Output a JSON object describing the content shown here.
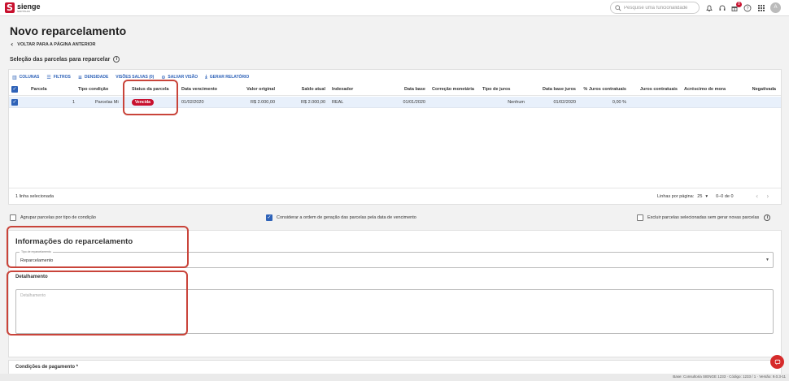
{
  "brand": {
    "name": "sienge",
    "sub": "SOFTPLAN"
  },
  "search": {
    "placeholder": "Pesquise uma funcionalidade"
  },
  "header_icons": [
    "bell-icon",
    "headset-icon",
    "gift-icon",
    "help-icon",
    "apps-grid-icon"
  ],
  "notification_count": "8",
  "avatar_letter": "A",
  "page": {
    "title": "Novo reparcelamento",
    "back_label": "VOLTAR PARA A PÁGINA ANTERIOR",
    "section_label": "Seleção das parcelas para reparcelar"
  },
  "toolbar": {
    "columns": "COLUNAS",
    "filters": "FILTROS",
    "density": "DENSIDADE",
    "saved_views": "VISÕES SALVAS (0)",
    "save_view": "SALVAR VISÃO",
    "report": "GERAR RELATÓRIO"
  },
  "table": {
    "headers": [
      "Parcela",
      "Tipo condição",
      "Status da parcela",
      "Data vencimento",
      "Valor original",
      "Saldo atual",
      "Indexador",
      "Data base",
      "Correção monetária",
      "Tipo de juros",
      "Data base juros",
      "% Juros contratuais",
      "Juros contratuais",
      "Acréscimo de mora",
      "Negativada"
    ],
    "rows": [
      {
        "parcela": "1",
        "tipo_condicao": "Parcelas Mi",
        "status": "Vencida",
        "data_vencimento": "01/02/2020",
        "valor_original": "R$ 2.000,00",
        "saldo_atual": "R$ 2.000,00",
        "indexador": "REAL",
        "data_base": "01/01/2020",
        "correcao": "",
        "tipo_juros": "Nenhum",
        "data_base_juros": "01/02/2020",
        "perc_juros": "0,00 %",
        "juros": "",
        "acrescimo": "",
        "negativada": ""
      }
    ],
    "selected_text": "1 linha selecionada",
    "rows_per_page_label": "Linhas por página:",
    "rows_per_page": "25",
    "range": "0–0 de 0"
  },
  "options": {
    "group": "Agrupar parcelas por tipo de condição",
    "order": "Considerar a ordem de geração das parcelas pela data de vencimento",
    "exclude": "Excluir parcelas selecionadas sem gerar novas parcelas"
  },
  "info": {
    "title": "Informações do reparcelamento",
    "type_label": "Tipo de reparcelamento",
    "type_value": "Reparcelamento",
    "detail_label": "Detalhamento",
    "detail_placeholder": "Detalhamento"
  },
  "payment": {
    "title": "Condições de pagamento *"
  },
  "status_bar": "Base: Consultoria SIENGE 1233 · Código: 1233 / 1 · Versão: 9.0.3-11",
  "colors": {
    "accent": "#2e62b8",
    "danger": "#c8102e",
    "highlight": "#c9443a"
  }
}
